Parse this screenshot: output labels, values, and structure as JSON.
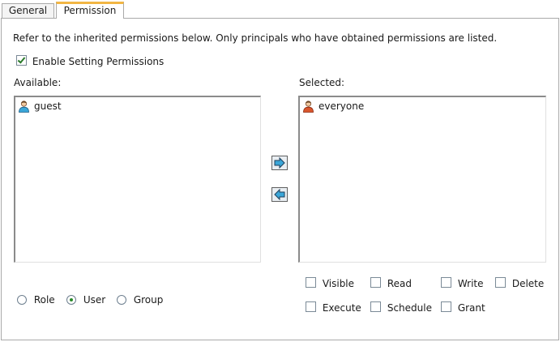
{
  "tabs": [
    {
      "label": "General",
      "active": false
    },
    {
      "label": "Permission",
      "active": true
    }
  ],
  "info_text": "Refer to the inherited permissions below. Only principals who have obtained permissions are listed.",
  "enable_setting": {
    "label": "Enable Setting Permissions",
    "checked": true
  },
  "available": {
    "label": "Available:",
    "items": [
      {
        "name": "guest",
        "icon": "user-icon"
      }
    ]
  },
  "selected": {
    "label": "Selected:",
    "items": [
      {
        "name": "everyone",
        "icon": "user-icon"
      }
    ]
  },
  "buttons": {
    "add_icon": "arrow-right-icon",
    "remove_icon": "arrow-left-icon"
  },
  "principal_type": {
    "options": [
      "Role",
      "User",
      "Group"
    ],
    "selected": "User"
  },
  "permissions": [
    {
      "label": "Visible",
      "checked": false
    },
    {
      "label": "Read",
      "checked": false
    },
    {
      "label": "Write",
      "checked": false
    },
    {
      "label": "Delete",
      "checked": false
    },
    {
      "label": "Execute",
      "checked": false
    },
    {
      "label": "Schedule",
      "checked": false
    },
    {
      "label": "Grant",
      "checked": false
    }
  ],
  "colors": {
    "active_tab_accent": "#f2b644",
    "check_green": "#2a7a2a",
    "arrow_blue": "#3aa6d8"
  }
}
